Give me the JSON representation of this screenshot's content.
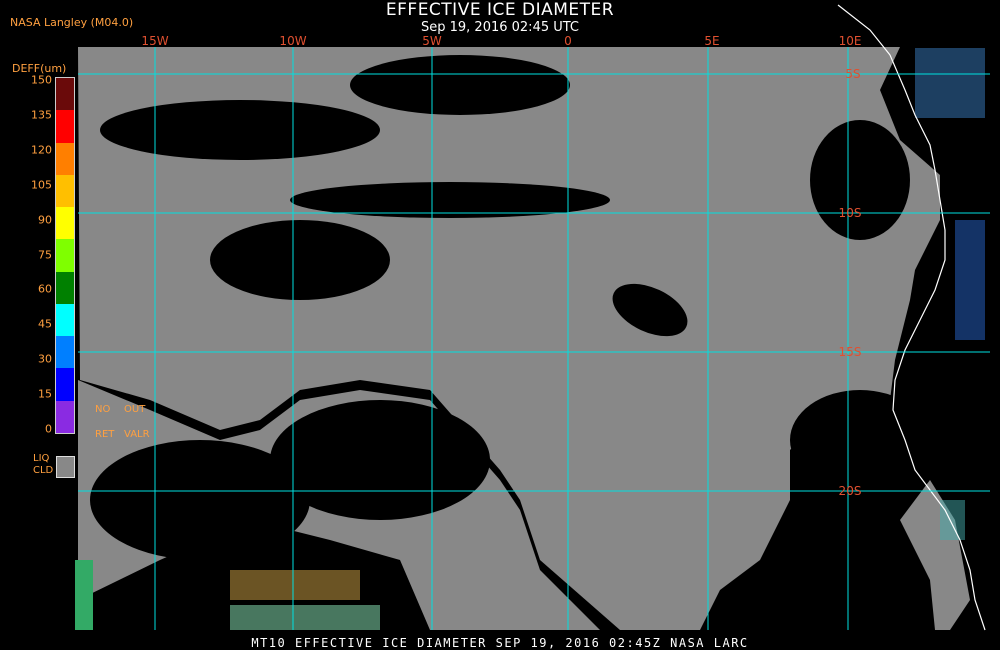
{
  "header": {
    "title": "EFFECTIVE ICE DIAMETER",
    "date": "Sep 19, 2016 02:45 UTC"
  },
  "source": "NASA Langley (M04.0)",
  "longitude_labels": [
    "15W",
    "10W",
    "5W",
    "0",
    "5E",
    "10E"
  ],
  "latitude_labels": [
    "5S",
    "10S",
    "15S",
    "20S"
  ],
  "legend": {
    "title": "DEFF(um)",
    "ticks": [
      "150",
      "135",
      "120",
      "105",
      "90",
      "75",
      "60",
      "45",
      "30",
      "15",
      "0"
    ],
    "colors": [
      "#6a0a0a",
      "#ff0000",
      "#ff7f00",
      "#ffbf00",
      "#ffff00",
      "#7fff00",
      "#008000",
      "#00ffff",
      "#007fff",
      "#0000ff",
      "#8a2be2"
    ],
    "no_retrieval_line1": "NO",
    "no_retrieval_line2": "RET",
    "out_of_range_line1": "OUT",
    "out_of_range_line2": "VALR",
    "liquid_cloud_line1": "LIQ",
    "liquid_cloud_line2": "CLD",
    "liquid_cloud_color": "#888888"
  },
  "footer": "MT10  EFFECTIVE ICE DIAMETER   SEP 19, 2016 02:45Z   NASA LARC",
  "colors": {
    "grid": "#00e0e0",
    "coastline": "#ffffff",
    "labels": "#e05030",
    "legend_text": "#ffa040"
  }
}
